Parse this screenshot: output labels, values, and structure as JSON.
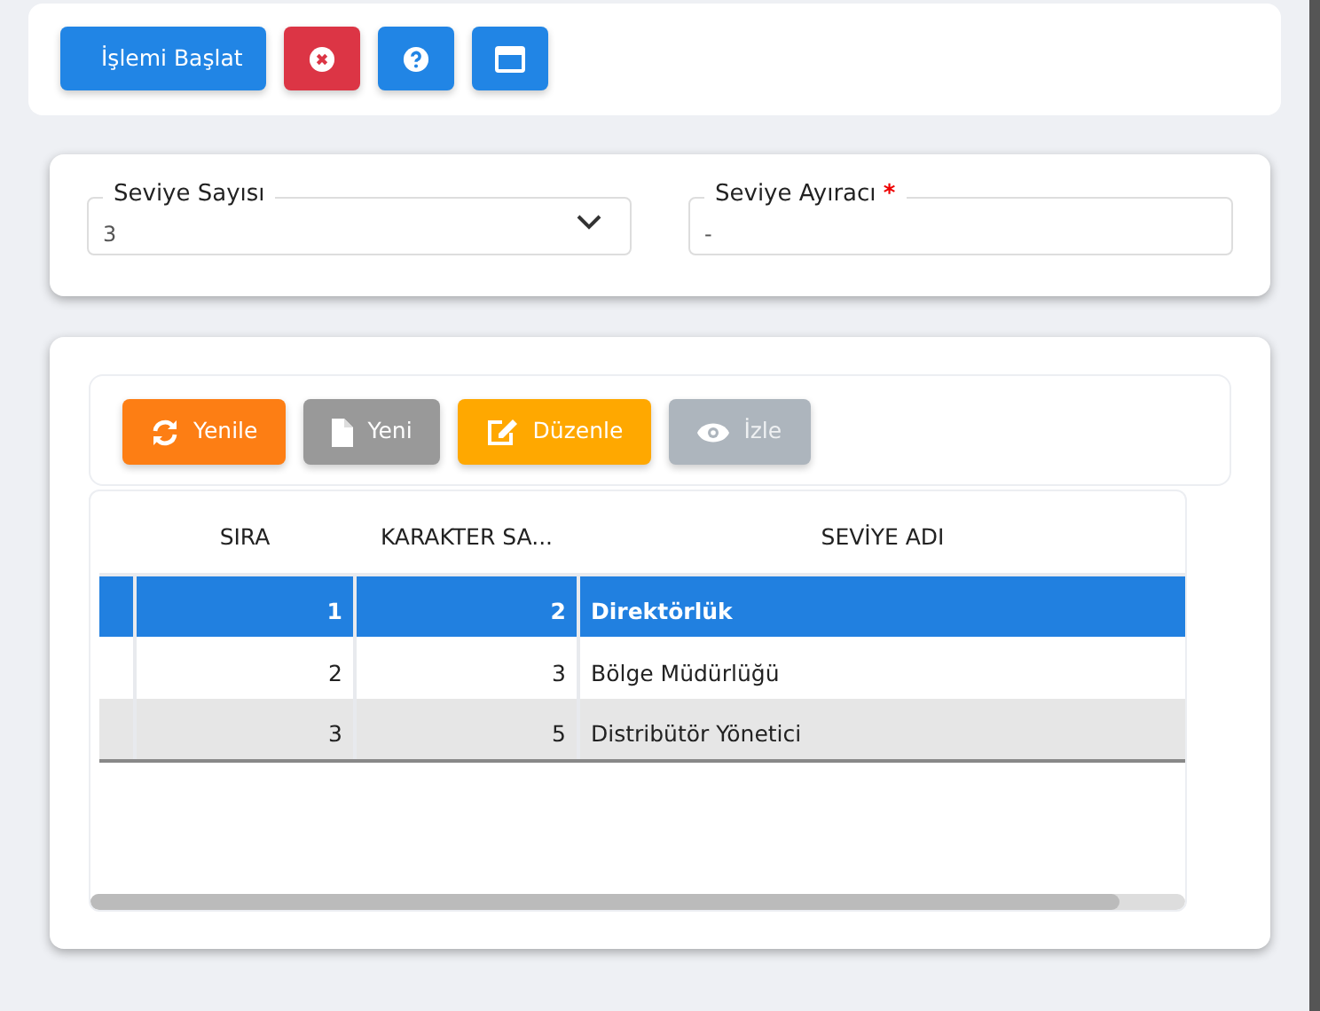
{
  "top_toolbar": [
    {
      "kind": "text",
      "label": "İşlemi Başlat"
    },
    {
      "kind": "close"
    },
    {
      "kind": "help"
    },
    {
      "kind": "window"
    }
  ],
  "form": {
    "fields": [
      {
        "kind": "select",
        "label": "Seviye Sayısı",
        "value": "3"
      },
      {
        "kind": "text",
        "label": "Seviye Ayıracı",
        "required_mark": "*",
        "value": "-"
      }
    ]
  },
  "grid_toolbar": [
    {
      "label": "Yenile",
      "disabled": false
    },
    {
      "label": "Yeni",
      "disabled": false
    },
    {
      "label": "Düzenle",
      "disabled": false
    },
    {
      "label": "İzle",
      "disabled": true
    }
  ],
  "table": {
    "columns": [
      "SIRA",
      "KARAKTER SA...",
      "SEVİYE ADI"
    ],
    "rows": [
      {
        "cells": [
          "1",
          "2",
          "Direktörlük"
        ],
        "selected": true
      },
      {
        "cells": [
          "2",
          "3",
          "Bölge Müdürlüğü"
        ],
        "selected": false
      },
      {
        "cells": [
          "3",
          "5",
          "Distribütör Yönetici"
        ],
        "selected": false
      }
    ]
  }
}
